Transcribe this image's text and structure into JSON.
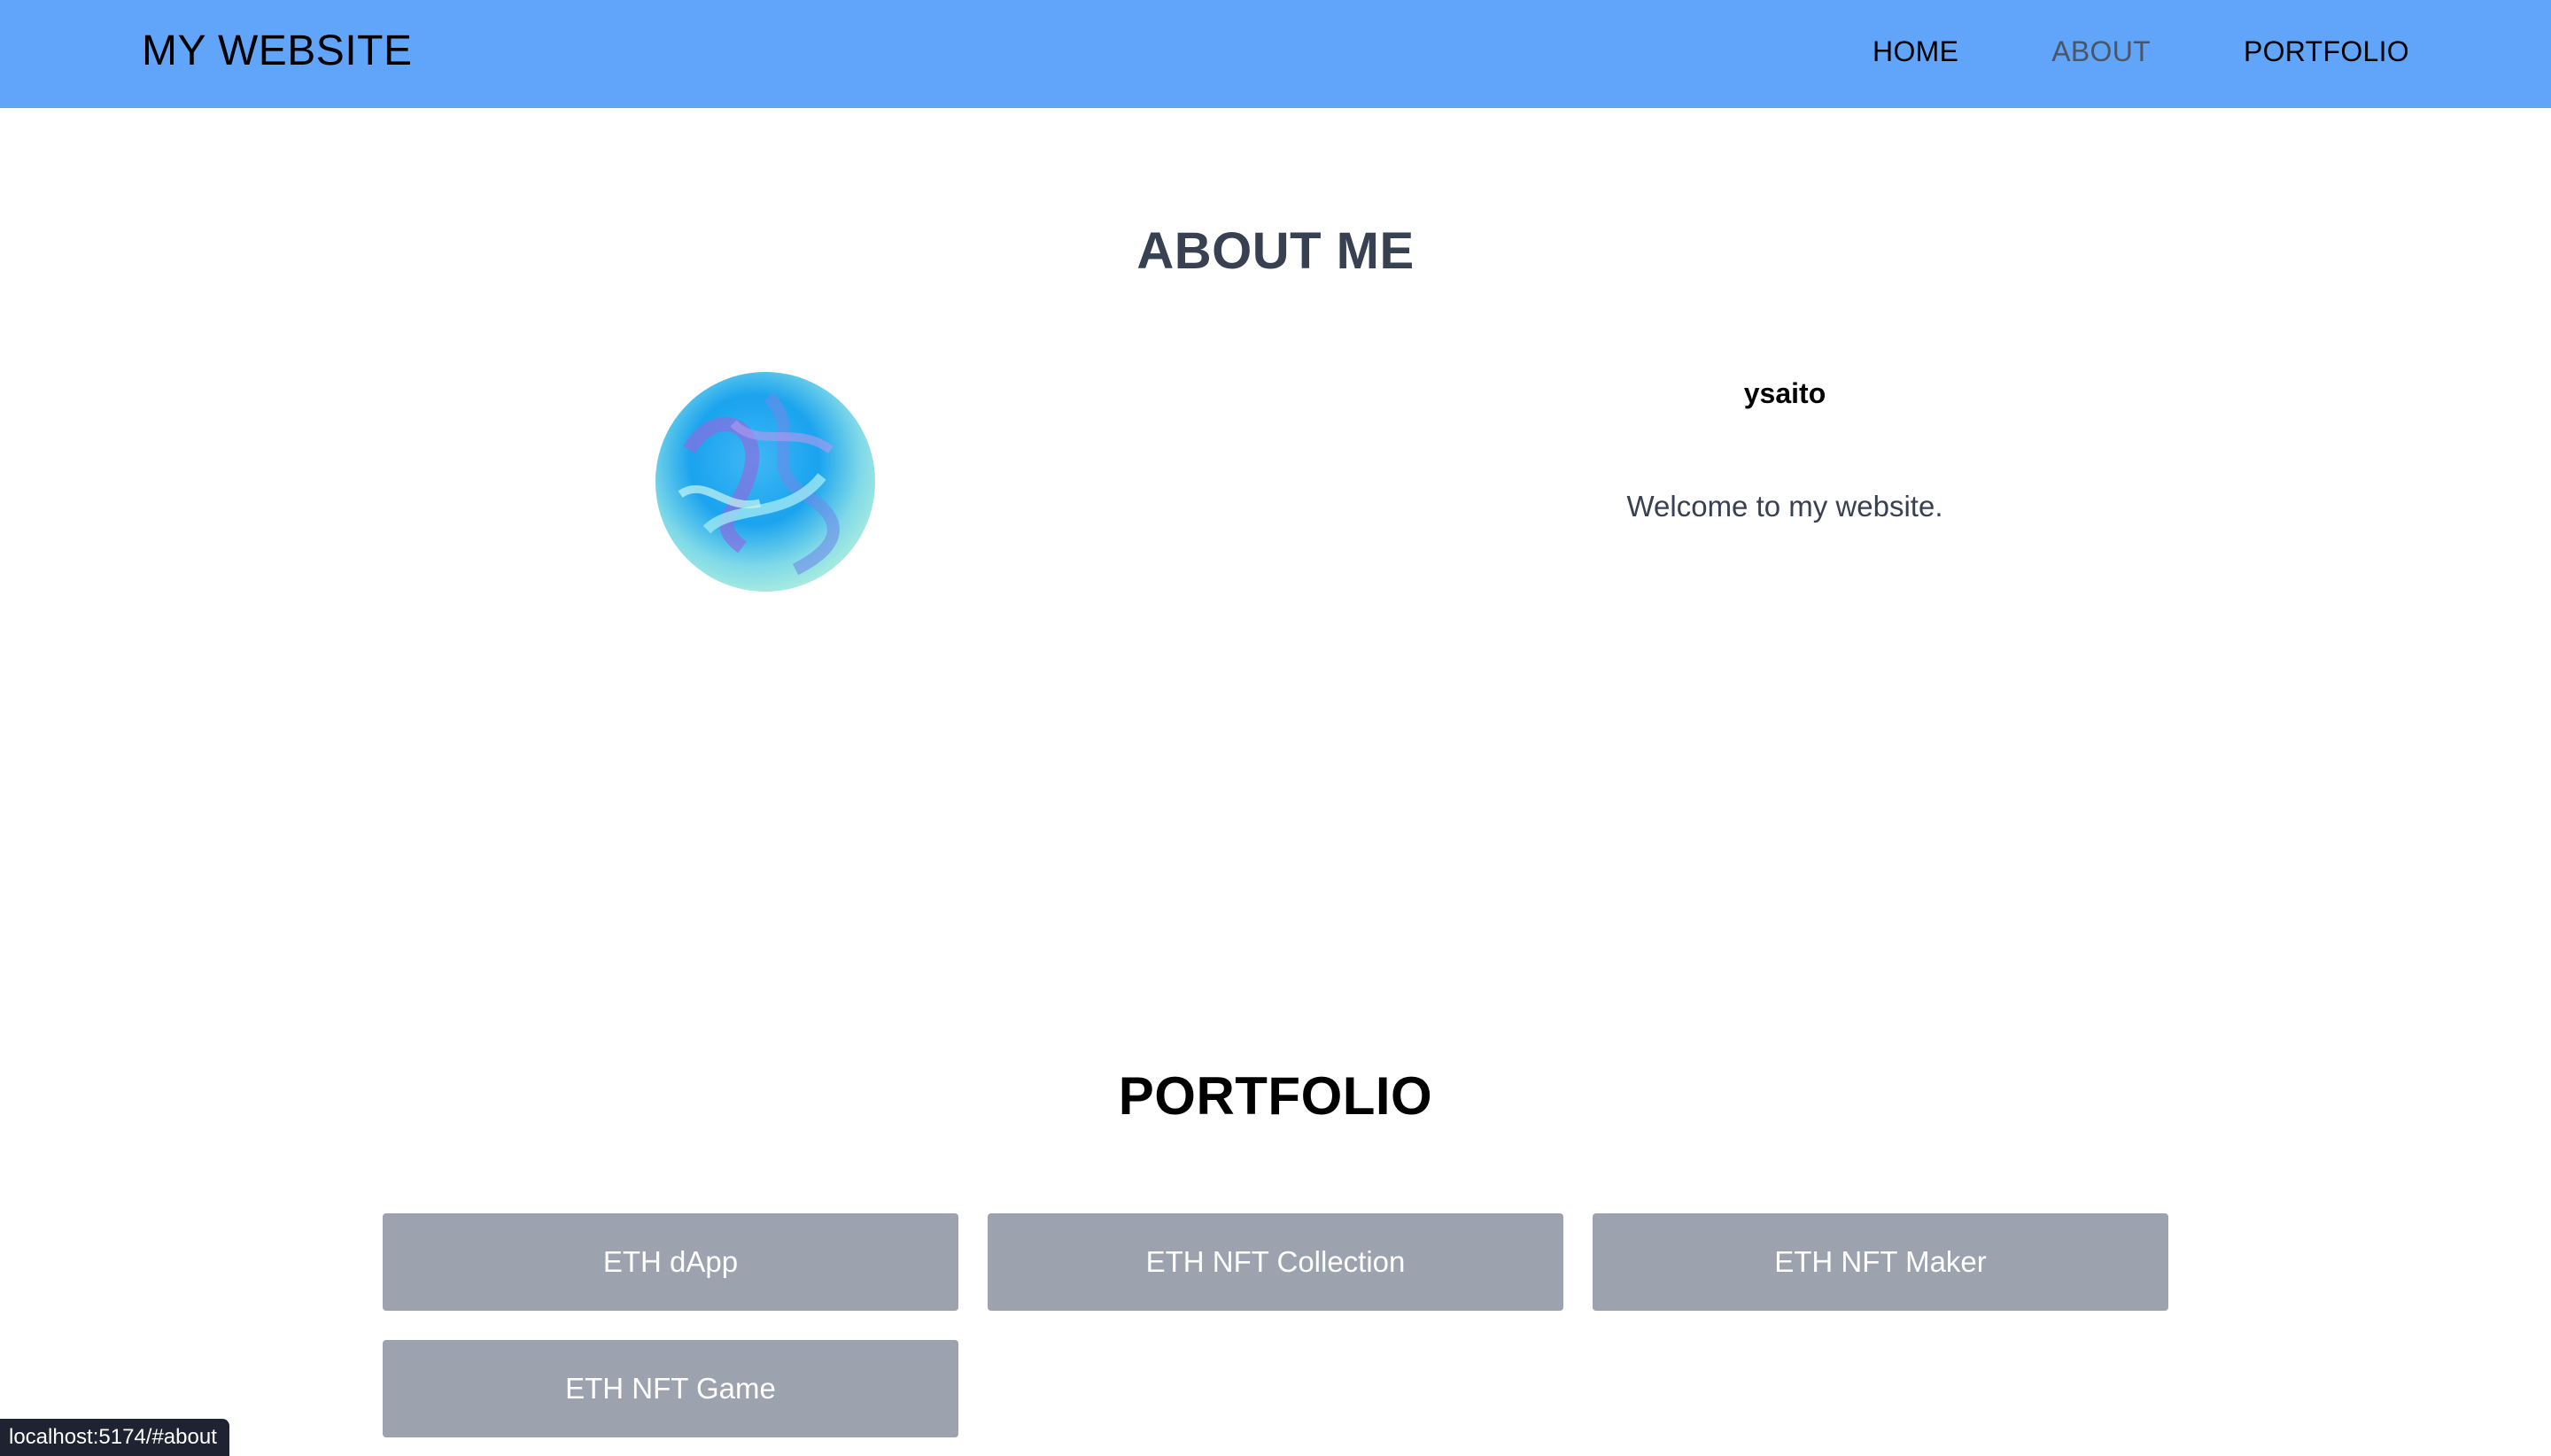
{
  "header": {
    "site_title": "MY WEBSITE",
    "nav": [
      {
        "label": "HOME",
        "active": false
      },
      {
        "label": "ABOUT",
        "active": true
      },
      {
        "label": "PORTFOLIO",
        "active": false
      }
    ]
  },
  "about": {
    "heading": "ABOUT ME",
    "name": "ysaito",
    "bio": "Welcome to my website."
  },
  "portfolio": {
    "heading": "PORTFOLIO",
    "items": [
      "ETH dApp",
      "ETH NFT Collection",
      "ETH NFT Maker",
      "ETH NFT Game"
    ]
  },
  "status_bar": {
    "url": "localhost:5174/#about"
  },
  "colors": {
    "header_bg": "#60a5fa",
    "card_bg": "#9ca3af",
    "active_nav": "#4b5563"
  }
}
